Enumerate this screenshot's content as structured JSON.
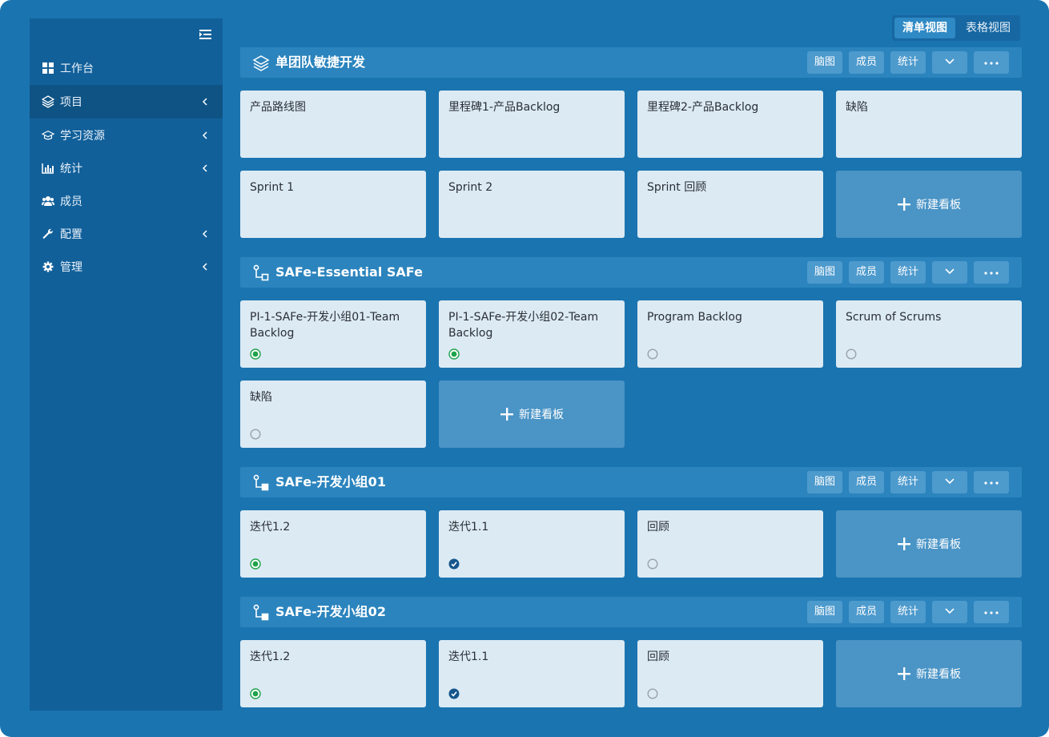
{
  "view_toggle": {
    "list_view": "清单视图",
    "table_view": "表格视图"
  },
  "sidebar": {
    "items": [
      {
        "label": "工作台"
      },
      {
        "label": "项目"
      },
      {
        "label": "学习资源"
      },
      {
        "label": "统计"
      },
      {
        "label": "成员"
      },
      {
        "label": "配置"
      },
      {
        "label": "管理"
      }
    ]
  },
  "header_buttons": {
    "mindmap": "脑图",
    "members": "成员",
    "stats": "统计"
  },
  "sections": [
    {
      "title": "单团队敏捷开发",
      "icon": "layers-icon",
      "cards": [
        {
          "title": "产品路线图"
        },
        {
          "title": "里程碑1-产品Backlog"
        },
        {
          "title": "里程碑2-产品Backlog"
        },
        {
          "title": "缺陷"
        },
        {
          "title": "Sprint 1"
        },
        {
          "title": "Sprint 2"
        },
        {
          "title": "Sprint 回顾"
        }
      ],
      "add_label": "新建看板"
    },
    {
      "title": "SAFe-Essential SAFe",
      "icon": "hierarchy-icon",
      "cards": [
        {
          "title": "PI-1-SAFe-开发小组01-Team Backlog",
          "status": "active"
        },
        {
          "title": "PI-1-SAFe-开发小组02-Team Backlog",
          "status": "active"
        },
        {
          "title": "Program Backlog",
          "status": "pending"
        },
        {
          "title": "Scrum of Scrums",
          "status": "pending"
        },
        {
          "title": "缺陷",
          "status": "pending"
        }
      ],
      "add_label": "新建看板"
    },
    {
      "title": "SAFe-开发小组01",
      "icon": "hierarchy-icon",
      "cards": [
        {
          "title": "迭代1.2",
          "status": "active"
        },
        {
          "title": "迭代1.1",
          "status": "done"
        },
        {
          "title": "回顾",
          "status": "pending"
        }
      ],
      "add_label": "新建看板"
    },
    {
      "title": "SAFe-开发小组02",
      "icon": "hierarchy-icon",
      "cards": [
        {
          "title": "迭代1.2",
          "status": "active"
        },
        {
          "title": "迭代1.1",
          "status": "done"
        },
        {
          "title": "回顾",
          "status": "pending"
        }
      ],
      "add_label": "新建看板"
    }
  ]
}
